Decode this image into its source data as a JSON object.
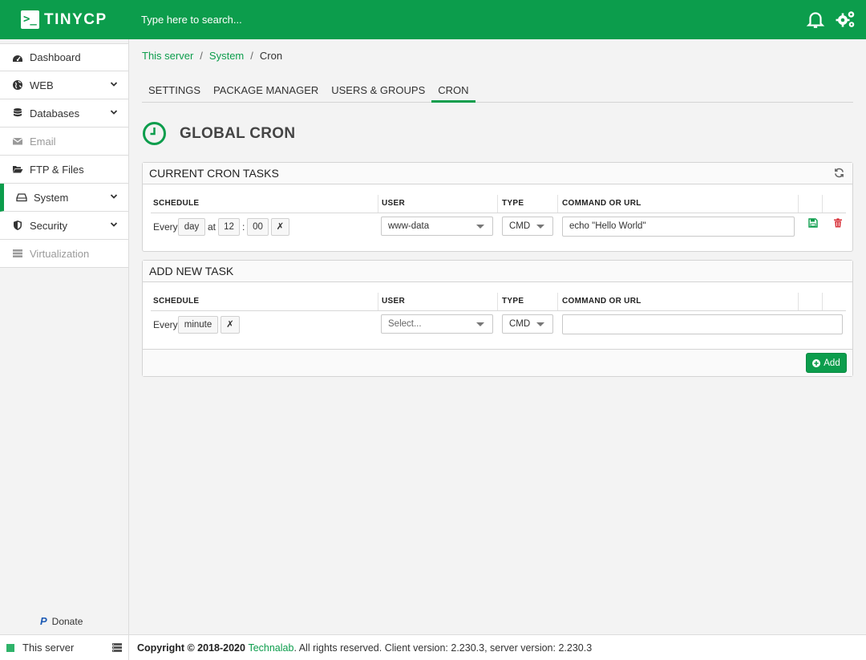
{
  "app": {
    "logo_text": "TINYCP",
    "logo_mark": ">_"
  },
  "header": {
    "search_placeholder": "Type here to search..."
  },
  "sidebar": {
    "items": [
      {
        "label": "Dashboard",
        "icon": "dashboard-icon"
      },
      {
        "label": "WEB",
        "icon": "globe-icon",
        "has_children": true
      },
      {
        "label": "Databases",
        "icon": "database-icon",
        "has_children": true
      },
      {
        "label": "Email",
        "icon": "envelope-icon",
        "disabled": true
      },
      {
        "label": "FTP & Files",
        "icon": "folder-open-icon"
      },
      {
        "label": "System",
        "icon": "hdd-icon",
        "has_children": true,
        "active": true
      },
      {
        "label": "Security",
        "icon": "shield-icon",
        "has_children": true
      },
      {
        "label": "Virtualization",
        "icon": "server-icon",
        "disabled": true
      }
    ],
    "donate_label": "Donate",
    "server_label": "This server"
  },
  "breadcrumb": {
    "item1": "This server",
    "item2": "System",
    "current": "Cron",
    "sep": "/"
  },
  "tabs": [
    {
      "label": "SETTINGS"
    },
    {
      "label": "PACKAGE MANAGER"
    },
    {
      "label": "USERS & GROUPS"
    },
    {
      "label": "CRON",
      "active": true
    }
  ],
  "page": {
    "title": "GLOBAL CRON"
  },
  "current_tasks": {
    "title": "CURRENT CRON TASKS",
    "columns": {
      "schedule": "SCHEDULE",
      "user": "USER",
      "type": "TYPE",
      "command": "COMMAND OR URL"
    },
    "rows": [
      {
        "every": "Every",
        "period": "day",
        "at": "at",
        "hour": "12",
        "colon": ":",
        "minute": "00",
        "clear": "✗",
        "user": "www-data",
        "type": "CMD",
        "command": "echo \"Hello World\""
      }
    ]
  },
  "add_task": {
    "title": "ADD NEW TASK",
    "columns": {
      "schedule": "SCHEDULE",
      "user": "USER",
      "type": "TYPE",
      "command": "COMMAND OR URL"
    },
    "every": "Every",
    "period": "minute",
    "clear": "✗",
    "user_placeholder": "Select...",
    "type": "CMD",
    "command": "",
    "add_label": "Add"
  },
  "footer": {
    "copyright": "Copyright © 2018-2020",
    "company": "Technalab",
    "rest": ". All rights reserved. Client version: 2.230.3, server version: 2.230.3"
  },
  "colors": {
    "brand": "#0c9d4c",
    "danger": "#d9363e"
  }
}
